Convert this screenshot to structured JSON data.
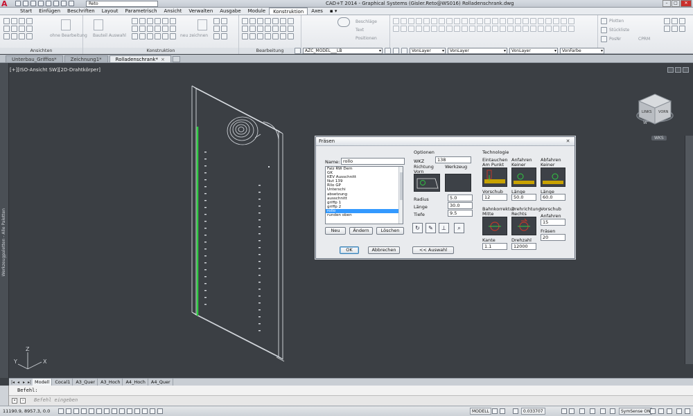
{
  "titlebar": {
    "workspace": "Reto",
    "title": "CAD+T 2014 - Graphical Systems  (Gisler.Reto@WS016)     Rolladenschrank.dwg",
    "close_glyph": "✕",
    "min_glyph": "–",
    "max_glyph": "□"
  },
  "menu": {
    "items": [
      "Start",
      "Einfügen",
      "Beschriften",
      "Layout",
      "Parametrisch",
      "Ansicht",
      "Verwalten",
      "Ausgabe",
      "Module",
      "Konstruktion",
      "Axes"
    ],
    "active": "Konstruktion",
    "extra": "▪ ▾"
  },
  "ribbon": {
    "groups": [
      {
        "label": "Ansichten"
      },
      {
        "label": "Konstruktion"
      },
      {
        "label": "Bearbeitung"
      }
    ],
    "ohne_bearbeitung": "ohne Bearbeitung",
    "bauteil_auswahl": "Bauteil Auswahl",
    "neu_zeichnen": "neu zeichnen",
    "beschlaege": "Beschläge",
    "text": "Text",
    "positionen": "Positionen",
    "plotten": "Plotten",
    "stueckliste": "Stückliste",
    "poslist": "PosNr",
    "cprm": "CPRM"
  },
  "layerbar": {
    "layer": "AZC_MODEL___LB",
    "color": "VonLayer",
    "linetype": "VonLayer",
    "lineweight": "VonLayer",
    "plotstyle": "VonFarbe"
  },
  "doctabs": {
    "tabs": [
      "Unterbau_Griffios*",
      "Zeichnung1*",
      "Rolladenschrank*"
    ],
    "active": "Rolladenschrank*",
    "close": "×"
  },
  "viewport": {
    "label": "[+][ISO-Ansicht SW][2D-Drahtkörper]",
    "palette": "Werkzeugpaletten - Alle Paletten",
    "viewcube_right": "LINKS",
    "viewcube_front": "VORN",
    "viewcube_compass": "W",
    "wks": "WKS",
    "axis_x": "X",
    "axis_y": "Y",
    "axis_z": "Z"
  },
  "dialog": {
    "title": "Fräsen",
    "close": "✕",
    "name_label": "Name:",
    "name_value": "rollo",
    "list_items": [
      "Falz RW Dem",
      "GK",
      "KEV Ausschnitt",
      "Nut 139",
      "Rllo GP",
      "Unterschi",
      "absetzung",
      "ausschnitt",
      "griffp 1",
      "griffp 2",
      "rollo",
      "runden oben"
    ],
    "selected_item": "rollo",
    "btn_neu": "Neu",
    "btn_aendern": "Ändern",
    "btn_loeschen": "Löschen",
    "btn_ok": "OK",
    "btn_abbrechen": "Abbrechen",
    "btn_auswahl": "<< Auswahl",
    "optionen": "Optionen",
    "wkz_label": "WKZ",
    "wkz_value": "138",
    "richtung_label": "Richtung",
    "richtung_value": "Vorn",
    "werkzeug_label": "Werkzeug",
    "radius_label": "Radius",
    "radius_value": "5.0",
    "laenge_label": "Länge",
    "laenge_value": "30.0",
    "tiefe_label": "Tiefe",
    "tiefe_value": "9.5",
    "technologie": "Technologie",
    "eintauchen_label": "Eintauchen",
    "eintauchen_value": "Am Punkt",
    "anfahren_label": "Anfahren",
    "anfahren_value": "Keiner",
    "abfahren_label": "Abfahren",
    "abfahren_value": "Keiner",
    "vorschub_label": "Vorschub",
    "vorschub_value": "12",
    "laenge2_label": "Länge",
    "laenge2_value": "50.0",
    "laenge3_label": "Länge",
    "laenge3_value": "60.0",
    "bahnkorrektur_label": "Bahnkorrektur",
    "bahnkorrektur_value": "Mitte",
    "drehrichtung_label": "Drehrichtung",
    "drehrichtung_value": "Rechts",
    "vorschub2_label": "Vorschub",
    "anfahren2_label": "Anfahren",
    "anfahren2_value": "15",
    "fraesen_label": "Fräsen",
    "fraesen_value": "20",
    "kante_label": "Kante",
    "kante_value": "1.1",
    "drehzahl_label": "Drehzahl",
    "drehzahl_value": "12000"
  },
  "layouttabs": {
    "nav": [
      "|◂",
      "◂",
      "▸",
      "▸|"
    ],
    "tabs": [
      "Modell",
      "Cocal1",
      "A3_Quer",
      "A3_Hoch",
      "A4_Hoch",
      "A4_Quer"
    ],
    "active": "Modell"
  },
  "command": {
    "history": "Befehl:",
    "prompt": "Befehl eingeben"
  },
  "status": {
    "coords": "11190.9, 8957.3, 0.0",
    "modell": "MODELL",
    "scale": "0.033707",
    "symsense": "SymSense ON"
  },
  "colors": {
    "canvas": "#3b3f44",
    "selection": "#3399ff",
    "accent_green": "#2ecc40",
    "wire": "#d9dde2"
  }
}
